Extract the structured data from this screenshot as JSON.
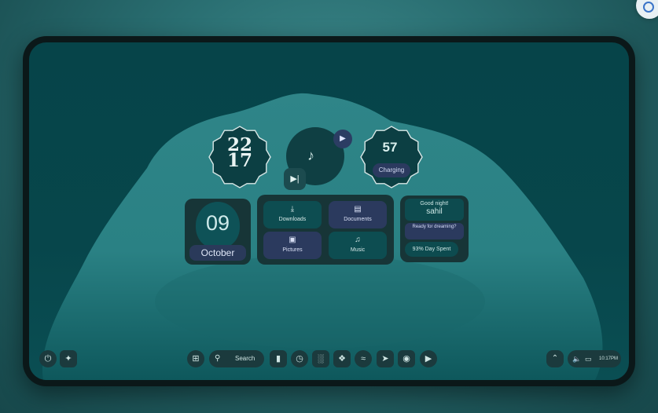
{
  "clock": {
    "hours": "22",
    "minutes": "17"
  },
  "music": {
    "note_icon": "music-note-icon",
    "play_icon": "play-icon",
    "skip_icon": "skip-next-icon"
  },
  "battery": {
    "level": "57",
    "status": "Charging"
  },
  "date": {
    "day": "09",
    "month": "October"
  },
  "folders": [
    {
      "label": "Downloads",
      "icon": "download-icon"
    },
    {
      "label": "Documents",
      "icon": "document-icon"
    },
    {
      "label": "Pictures",
      "icon": "image-icon"
    },
    {
      "label": "Music",
      "icon": "music-icon"
    }
  ],
  "greeting": {
    "title": "Good night!",
    "name": "sahil",
    "question": "Ready for dreaming?",
    "progress": "93% Day Spent"
  },
  "taskbar": {
    "search_label": "Search",
    "time": "10:17PM"
  },
  "colors": {
    "accent_teal": "#3a9698",
    "widget_blue": "#2b3a5e",
    "background": "#064449"
  }
}
